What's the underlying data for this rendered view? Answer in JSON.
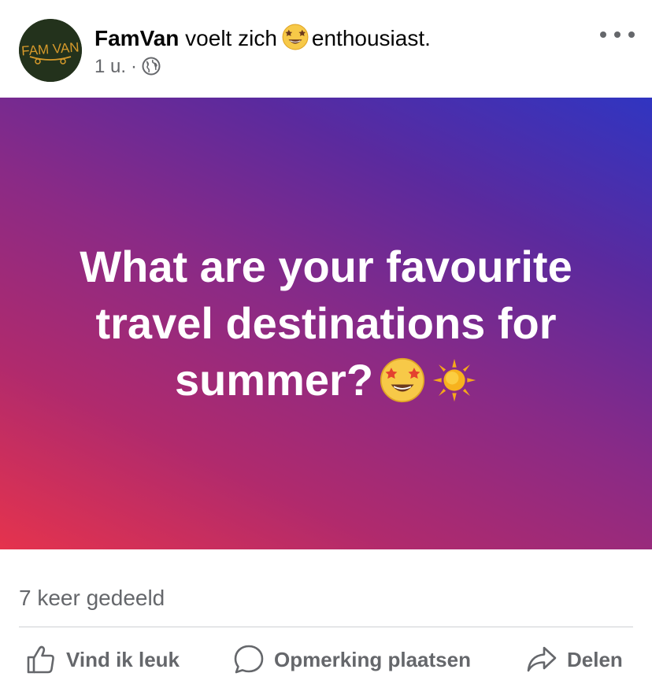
{
  "post": {
    "author": "FamVan",
    "feeling_prefix": "voelt zich",
    "feeling_emoji": "star-struck-emoji",
    "feeling_word": "enthousiast.",
    "time": "1 u.",
    "separator": "·",
    "audience_icon": "globe-icon",
    "avatar_text": "FAM VAN",
    "more_icon": "more-options-icon",
    "body_text": "What are your favourite travel destinations for summer?",
    "body_emojis": [
      "star-struck-emoji",
      "sun-emoji"
    ],
    "gradient_colors": [
      "#e5334d",
      "#8a2a86",
      "#3035c1"
    ]
  },
  "stats": {
    "shares": "7 keer gedeeld"
  },
  "actions": {
    "like_label": "Vind ik leuk",
    "comment_label": "Opmerking plaatsen",
    "share_label": "Delen"
  },
  "colors": {
    "secondary_text": "#65676b",
    "avatar_bg": "#23321c",
    "avatar_text": "#d79a2b"
  }
}
